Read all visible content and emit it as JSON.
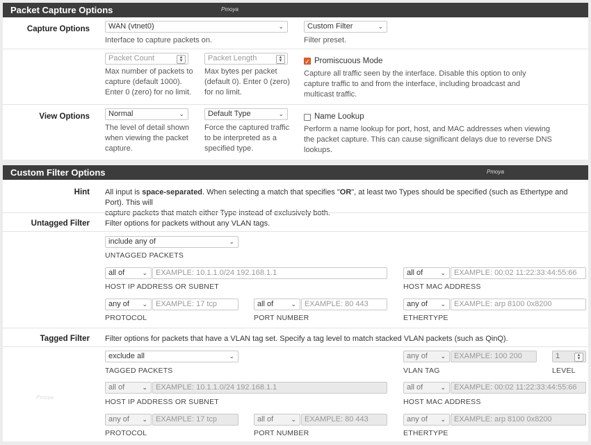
{
  "packet_capture": {
    "title": "Packet Capture Options",
    "capture_options": {
      "label": "Capture Options",
      "interface": {
        "value": "WAN (vtnet0)",
        "help": "Interface to capture packets on."
      },
      "filter_preset": {
        "value": "Custom Filter",
        "help": "Filter preset."
      }
    },
    "limits": {
      "packet_count": {
        "placeholder": "Packet Count",
        "help": [
          "Max number of packets to",
          "capture (default 1000).",
          "Enter 0 (zero) for no limit."
        ]
      },
      "packet_length": {
        "placeholder": "Packet Length",
        "help": [
          "Max bytes per packet",
          "(default 0). Enter 0 (zero)",
          "for no limit."
        ]
      },
      "promiscuous": {
        "label": "Promiscuous Mode",
        "checked": true,
        "help": [
          "Capture all traffic seen by the interface. Disable this option to only",
          "capture traffic to and from the interface, including broadcast and",
          "multicast traffic."
        ]
      }
    },
    "view_options": {
      "label": "View Options",
      "detail": {
        "value": "Normal",
        "help": [
          "The level of detail shown",
          "when viewing the packet",
          "capture."
        ]
      },
      "type": {
        "value": "Default Type",
        "help": [
          "Force the captured traffic",
          "to be interpreted as a",
          "specified type."
        ]
      },
      "name_lookup": {
        "label": "Name Lookup",
        "checked": false,
        "help": [
          "Perform a name lookup for port, host, and MAC addresses when viewing",
          "the packet capture. This can cause significant delays due to reverse DNS",
          "lookups."
        ]
      }
    }
  },
  "custom_filter": {
    "title": "Custom Filter Options",
    "hint": {
      "label": "Hint",
      "t1": "All input is ",
      "t2": "space-separated",
      "t3": ". When selecting a match that specifies \"",
      "t4": "OR",
      "t5": "\", at least two Types should be specified (such as Ethertype and Port). This will",
      "line2": "capture packets that match either Type instead of exclusively both."
    },
    "untagged": {
      "label": "Untagged Filter",
      "desc": "Filter options for packets without any VLAN tags.",
      "match": {
        "value": "include any of",
        "caption": "UNTAGGED PACKETS"
      },
      "host_ip": {
        "op": "all of",
        "placeholder": "EXAMPLE: 10.1.1.0/24 192.168.1.1",
        "caption": "HOST IP ADDRESS OR SUBNET"
      },
      "host_mac": {
        "op": "all of",
        "placeholder": "EXAMPLE: 00:02 11:22:33:44:55:66",
        "caption": "HOST MAC ADDRESS"
      },
      "protocol": {
        "op": "any of",
        "placeholder": "EXAMPLE: 17 tcp",
        "caption": "PROTOCOL"
      },
      "port": {
        "op": "all of",
        "placeholder": "EXAMPLE: 80 443",
        "caption": "PORT NUMBER"
      },
      "ethertype": {
        "op": "any of",
        "placeholder": "EXAMPLE: arp 8100 0x8200",
        "caption": "ETHERTYPE"
      }
    },
    "tagged": {
      "label": "Tagged Filter",
      "desc": "Filter options for packets that have a VLAN tag set. Specify a tag level to match stacked VLAN packets (such as QinQ).",
      "match": {
        "value": "exclude all",
        "caption": "TAGGED PACKETS"
      },
      "vlan_tag": {
        "op": "any of",
        "placeholder": "EXAMPLE: 100 200",
        "caption": "VLAN TAG"
      },
      "level": {
        "value": "1",
        "caption": "LEVEL"
      },
      "host_ip": {
        "op": "all of",
        "placeholder": "EXAMPLE: 10.1.1.0/24 192.168.1.1",
        "caption": "HOST IP ADDRESS OR SUBNET"
      },
      "host_mac": {
        "op": "all of",
        "placeholder": "EXAMPLE: 00:02 11:22:33:44:55:66",
        "caption": "HOST MAC ADDRESS"
      },
      "protocol": {
        "op": "any of",
        "placeholder": "EXAMPLE: 17 tcp",
        "caption": "PROTOCOL"
      },
      "port": {
        "op": "all of",
        "placeholder": "EXAMPLE: 80 443",
        "caption": "PORT NUMBER"
      },
      "ethertype": {
        "op": "any of",
        "placeholder": "EXAMPLE: arp 8100 0x8200",
        "caption": "ETHERTYPE"
      }
    }
  },
  "watermark": "Pmoya",
  "colors": {
    "heading_bg": "#3c3c3c",
    "accent": "#e2622b"
  }
}
